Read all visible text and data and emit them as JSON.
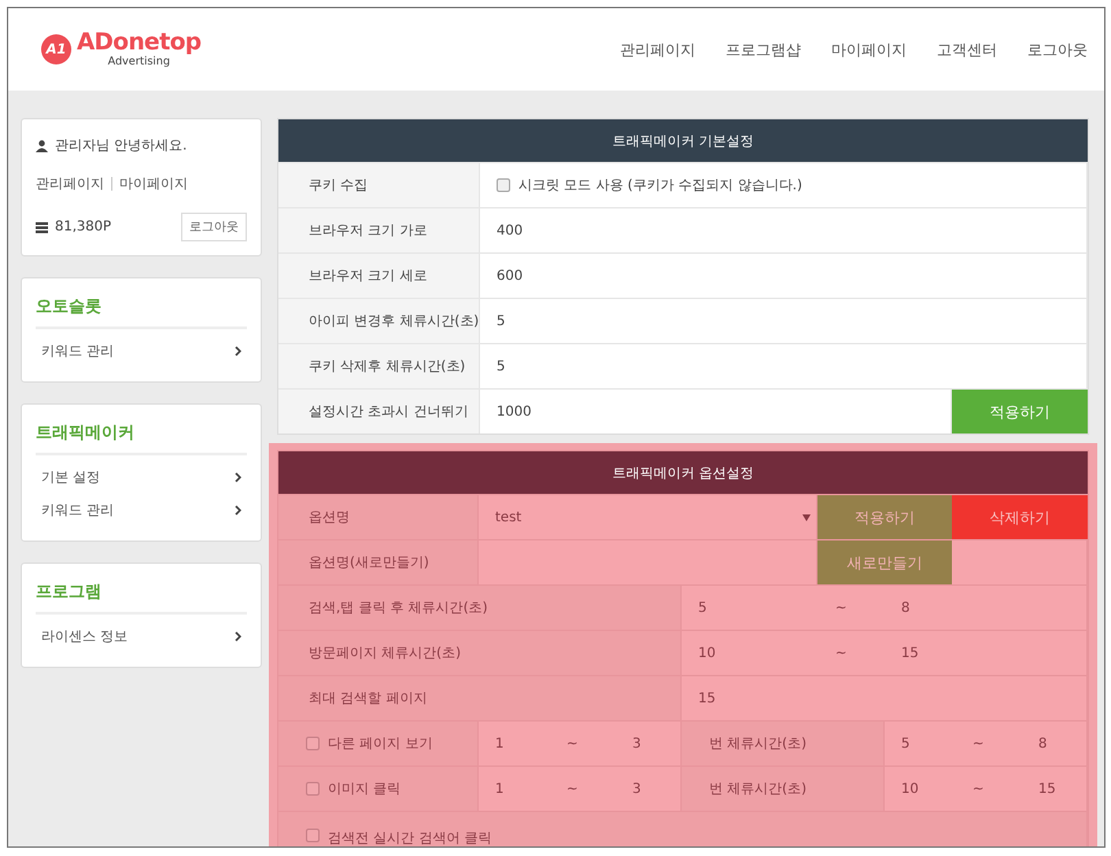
{
  "header": {
    "logo": {
      "mark": "A1",
      "name": "ADonetop",
      "tagline": "Advertising"
    },
    "nav": [
      "관리페이지",
      "프로그램샵",
      "마이페이지",
      "고객센터",
      "로그아웃"
    ]
  },
  "sidebar": {
    "user": {
      "greeting": "관리자님 안녕하세요.",
      "links": [
        "관리페이지",
        "마이페이지"
      ],
      "points": "81,380P",
      "logout": "로그아웃"
    },
    "menus": [
      {
        "title": "오토슬롯",
        "items": [
          "키워드 관리"
        ]
      },
      {
        "title": "트래픽메이커",
        "items": [
          "기본 설정",
          "키워드 관리"
        ]
      },
      {
        "title": "프로그램",
        "items": [
          "라이센스 정보"
        ]
      }
    ]
  },
  "basic_settings": {
    "title": "트래픽메이커 기본설정",
    "rows": [
      {
        "kind": "checkbox",
        "label": "쿠키 수집",
        "text": "시크릿 모드 사용 (쿠키가 수집되지 않습니다.)",
        "checked": false
      },
      {
        "kind": "value",
        "label": "브라우저 크기 가로",
        "value": "400"
      },
      {
        "kind": "value",
        "label": "브라우저 크기 세로",
        "value": "600"
      },
      {
        "kind": "value",
        "label": "아이피 변경후 체류시간(초)",
        "value": "5"
      },
      {
        "kind": "value",
        "label": "쿠키 삭제후 체류시간(초)",
        "value": "5"
      },
      {
        "kind": "value",
        "label": "설정시간 초과시 건너뛰기",
        "value": "1000"
      }
    ],
    "apply_button": "적용하기"
  },
  "option_settings": {
    "title": "트래픽메이커 옵션설정",
    "option_name": {
      "label": "옵션명",
      "value": "test"
    },
    "apply_button": "적용하기",
    "delete_button": "삭제하기",
    "new_name": {
      "label": "옵션명(새로만들기)"
    },
    "new_button": "새로만들기",
    "range_rows": [
      {
        "label": "검색,탭 클릭 후 체류시간(초)",
        "from": "5",
        "sep": "~",
        "to": "8"
      },
      {
        "label": "방문페이지 체류시간(초)",
        "from": "10",
        "sep": "~",
        "to": "15"
      }
    ],
    "max_pages": {
      "label": "최대 검색할 페이지",
      "value": "15"
    },
    "check_rows": [
      {
        "label": "다른 페이지 보기",
        "checked": false,
        "count_from": "1",
        "count_sep": "~",
        "count_to": "3",
        "unit": "번 체류시간(초)",
        "from": "5",
        "sep": "~",
        "to": "8"
      },
      {
        "label": "이미지 클릭",
        "checked": false,
        "count_from": "1",
        "count_sep": "~",
        "count_to": "3",
        "unit": "번 체류시간(초)",
        "from": "10",
        "sep": "~",
        "to": "15"
      }
    ],
    "last_row": {
      "label": "검색전 실시간 검색어 클릭",
      "checked": false
    }
  }
}
